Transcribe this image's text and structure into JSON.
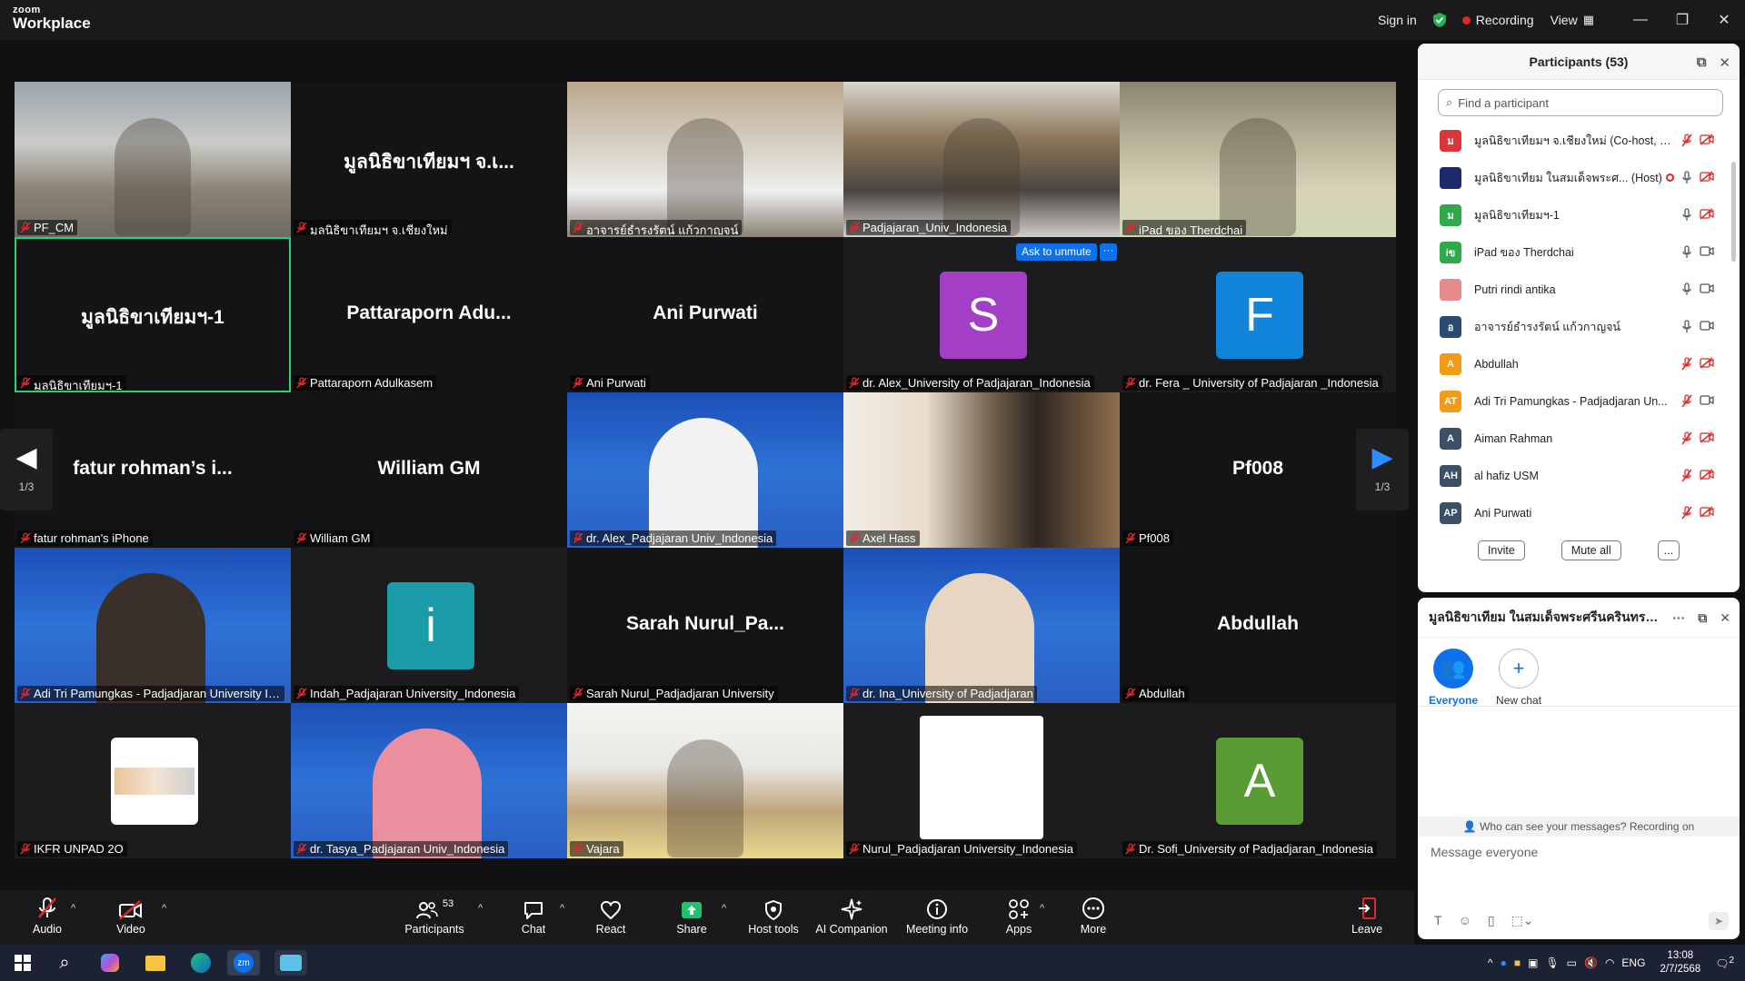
{
  "app": {
    "logo_small": "zoom",
    "logo_big": "Workplace"
  },
  "titlebar": {
    "sign_in": "Sign in",
    "recording": "Recording",
    "view": "View"
  },
  "tiles": [
    {
      "label": "PF_CM",
      "type": "video"
    },
    {
      "label": "มูลนิธิขาเทียมฯ จ.เชียงใหม่",
      "display": "มูลนิธิขาเทียมฯ จ.เ...",
      "type": "name"
    },
    {
      "label": "อาจารย์ธำรงรัตน์ แก้วกาญจน์",
      "type": "video"
    },
    {
      "label": "Padjajaran_Univ_Indonesia",
      "type": "video"
    },
    {
      "label": "iPad ของ Therdchai",
      "type": "video"
    },
    {
      "label": "มูลนิธิขาเทียมฯ-1",
      "display": "มูลนิธิขาเทียมฯ-1",
      "type": "name"
    },
    {
      "label": "Pattaraporn Adulkasem",
      "display": "Pattaraporn  Adu...",
      "type": "name"
    },
    {
      "label": "Ani Purwati",
      "display": "Ani Purwati",
      "type": "name"
    },
    {
      "label": "dr. Alex_University of Padjajaran_Indonesia",
      "letter": "S",
      "color": "#a33fc7",
      "type": "avatar"
    },
    {
      "label": "dr. Fera _ University of Padjajaran _Indonesia",
      "letter": "F",
      "color": "#0f84d8",
      "type": "avatar"
    },
    {
      "label": "fatur rohman's iPhone",
      "display": "fatur  rohman’s  i...",
      "type": "name"
    },
    {
      "label": "William GM",
      "display": "William GM",
      "type": "name"
    },
    {
      "label": "dr. Alex_Padjajaran Univ_Indonesia",
      "type": "video"
    },
    {
      "label": "Axel Hass",
      "type": "video"
    },
    {
      "label": "Pf008",
      "display": "Pf008",
      "type": "name"
    },
    {
      "label": "Adi Tri Pamungkas - Padjadjaran University In...",
      "type": "video"
    },
    {
      "label": "Indah_Padjajaran University_Indonesia",
      "letter": "i",
      "color": "#1a9ba8",
      "type": "avatar"
    },
    {
      "label": "Sarah  Nurul_Padjadjaran University",
      "display": "Sarah   Nurul_Pa...",
      "type": "name"
    },
    {
      "label": "dr. Ina_University of Padjadjaran",
      "type": "video"
    },
    {
      "label": "Abdullah",
      "display": "Abdullah",
      "type": "name"
    },
    {
      "label": "IKFR UNPAD 2O",
      "type": "photo"
    },
    {
      "label": "dr. Tasya_Padjajaran Univ_Indonesia",
      "type": "video"
    },
    {
      "label": "Vajara",
      "type": "video"
    },
    {
      "label": "Nurul_Padjadjaran University_Indonesia",
      "type": "whitebox"
    },
    {
      "label": "Dr. Sofi_University of Padjadjaran_Indonesia",
      "letter": "A",
      "color": "#5a9b34",
      "type": "avatar"
    }
  ],
  "pager": {
    "left": "1/3",
    "right": "1/3"
  },
  "ask_to_unmute": "Ask to unmute",
  "toolbar": {
    "audio": "Audio",
    "video": "Video",
    "participants": "Participants",
    "participants_count": "53",
    "chat": "Chat",
    "react": "React",
    "share": "Share",
    "host_tools": "Host tools",
    "ai_companion": "AI Companion",
    "meeting_info": "Meeting info",
    "apps": "Apps",
    "more": "More",
    "leave": "Leave"
  },
  "participants_panel": {
    "title": "Participants (53)",
    "search_placeholder": "Find a participant",
    "rows": [
      {
        "initials": "ม",
        "name": "มูลนิธิขาเทียมฯ จ.เชียงใหม่ (Co-host, me)",
        "color": "#d9373b",
        "mic": "muted",
        "cam": "off"
      },
      {
        "initials": "",
        "name": "มูลนิธิขาเทียม ในสมเด็จพระศ...  (Host)",
        "color": "#1d2a6b",
        "mic": "on",
        "cam": "off"
      },
      {
        "initials": "ม",
        "name": "มูลนิธิขาเทียมฯ-1",
        "color": "#2eaa4a",
        "mic": "on",
        "cam": "off"
      },
      {
        "initials": "iข",
        "name": "iPad ของ Therdchai",
        "color": "#2eaa4a",
        "mic": "on",
        "cam": "on"
      },
      {
        "initials": "",
        "name": "Putri rindi antika",
        "color": "#e58b8b",
        "mic": "on",
        "cam": "on"
      },
      {
        "initials": "อ",
        "name": "อาจารย์ธำรงรัตน์ แก้วกาญจน์",
        "color": "#2b4a6f",
        "mic": "on",
        "cam": "on"
      },
      {
        "initials": "A",
        "name": "Abdullah",
        "color": "#f29b18",
        "mic": "muted",
        "cam": "off"
      },
      {
        "initials": "AT",
        "name": "Adi Tri Pamungkas - Padjadjaran Un...",
        "color": "#f29b18",
        "mic": "muted",
        "cam": "on"
      },
      {
        "initials": "A",
        "name": "Aiman Rahman",
        "color": "#3d4f66",
        "mic": "muted",
        "cam": "off"
      },
      {
        "initials": "AH",
        "name": "al hafiz USM",
        "color": "#3d4f66",
        "mic": "muted",
        "cam": "off"
      },
      {
        "initials": "AP",
        "name": "Ani Purwati",
        "color": "#3d4f66",
        "mic": "muted",
        "cam": "off"
      }
    ],
    "invite": "Invite",
    "mute_all": "Mute all",
    "more": "..."
  },
  "chat_panel": {
    "title": "มูลนิธิขาเทียม ในสมเด็จพระศรีนครินทราบ...",
    "everyone": "Everyone",
    "new_chat": "New chat",
    "who_can_see": "Who can see your messages? Recording on",
    "placeholder": "Message everyone"
  },
  "taskbar": {
    "lang": "ENG",
    "time": "13:08",
    "date": "2/7/2568",
    "notif": "2"
  },
  "colors": {
    "accent": "#0e71eb",
    "active_speaker": "#26d07c",
    "recording": "#e02828",
    "share": "#1fc16b"
  }
}
